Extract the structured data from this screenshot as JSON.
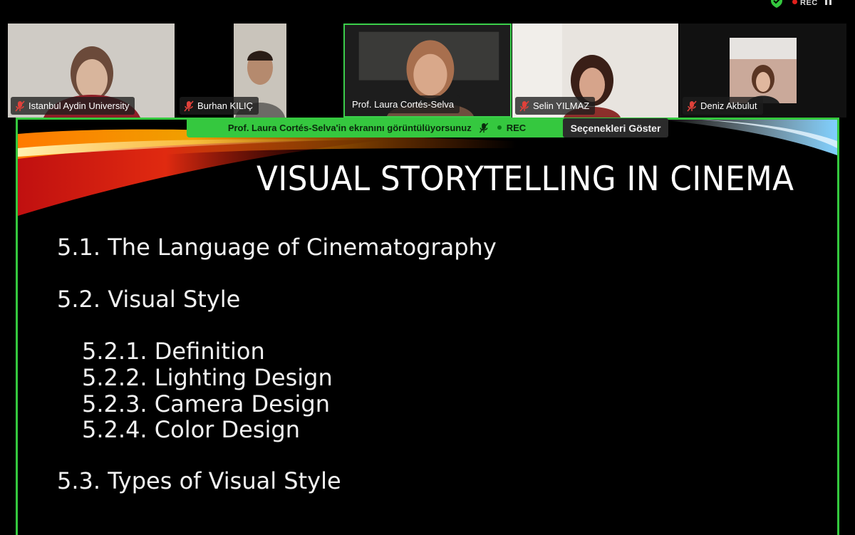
{
  "status_bar": {
    "rec_label": "REC"
  },
  "participants": [
    {
      "name": "Istanbul Aydin University",
      "muted": true
    },
    {
      "name": "Burhan KILIÇ",
      "muted": true
    },
    {
      "name": "Prof. Laura Cortés-Selva",
      "muted": false,
      "active_speaker": true
    },
    {
      "name": "Selin YILMAZ",
      "muted": true
    },
    {
      "name": "Deniz Akbulut",
      "muted": true
    }
  ],
  "share_banner": {
    "text": "Prof. Laura Cortés-Selva'in ekranını görüntülüyorsunuz",
    "rec_label": "REC",
    "options_label": "Seçenekleri Göster"
  },
  "slide": {
    "title": "VISUAL STORYTELLING IN CINEMA",
    "outline": [
      "5.1. The Language of Cinematography",
      "5.2. Visual Style",
      "5.2.1. Definition",
      "5.2.2. Lighting Design",
      "5.2.3. Camera Design",
      "5.2.4. Color Design",
      "5.3. Types of Visual Style"
    ]
  },
  "colors": {
    "active_border": "#3bcf4b",
    "banner_bg": "#35c83f",
    "muted_mic": "#e0413a"
  }
}
